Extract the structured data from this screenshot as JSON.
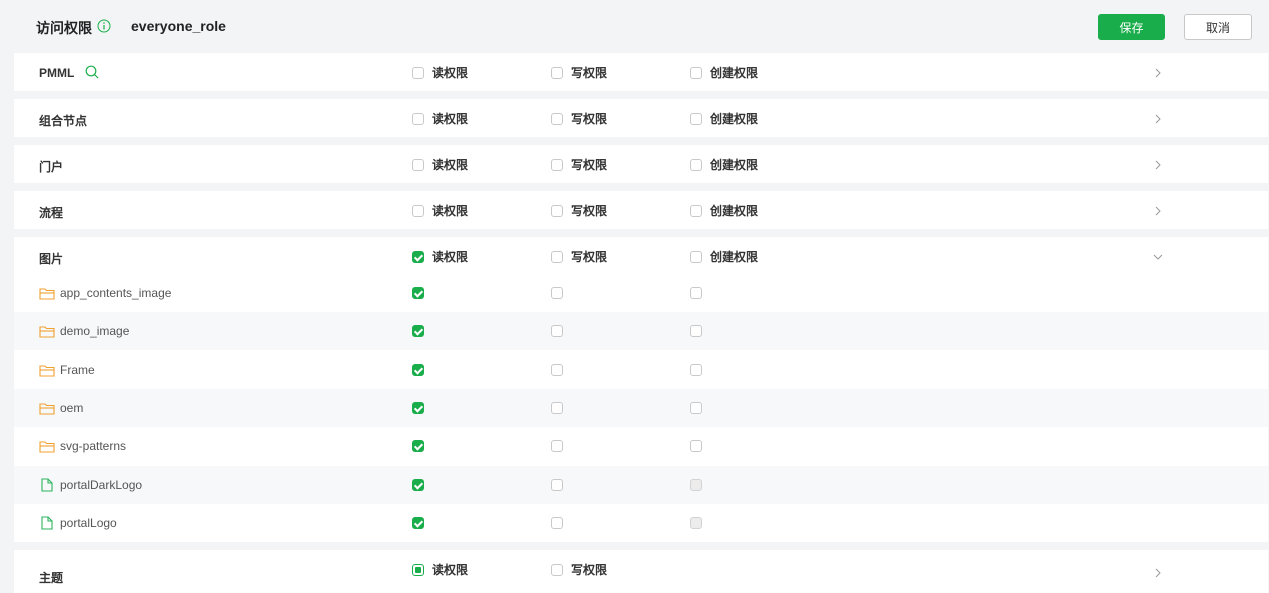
{
  "header": {
    "title": "访问权限",
    "role": "everyone_role",
    "save_label": "保存",
    "cancel_label": "取消"
  },
  "perm_labels": {
    "read": "读权限",
    "write": "写权限",
    "create": "创建权限"
  },
  "categories": [
    {
      "name": "PMML",
      "read": false,
      "write": false,
      "create": false,
      "expanded": false
    },
    {
      "name": "组合节点",
      "read": false,
      "write": false,
      "create": false,
      "expanded": false
    },
    {
      "name": "门户",
      "read": false,
      "write": false,
      "create": false,
      "expanded": false
    },
    {
      "name": "流程",
      "read": false,
      "write": false,
      "create": false,
      "expanded": false
    },
    {
      "name": "图片",
      "read": true,
      "write": false,
      "create": false,
      "expanded": true
    },
    {
      "name": "主题",
      "read": "partial",
      "write": false,
      "expanded": false
    }
  ],
  "image_items": [
    {
      "name": "app_contents_image",
      "icon": "folder-icon",
      "read": true,
      "write": false,
      "create": false
    },
    {
      "name": "demo_image",
      "icon": "folder-icon",
      "read": true,
      "write": false,
      "create": false
    },
    {
      "name": "Frame",
      "icon": "folder-icon",
      "read": true,
      "write": false,
      "create": false
    },
    {
      "name": "oem",
      "icon": "folder-icon",
      "read": true,
      "write": false,
      "create": false
    },
    {
      "name": "svg-patterns",
      "icon": "folder-icon",
      "read": true,
      "write": false,
      "create": false
    },
    {
      "name": "portalDarkLogo",
      "icon": "file-icon",
      "read": true,
      "write": false,
      "create": "disabled"
    },
    {
      "name": "portalLogo",
      "icon": "file-icon",
      "read": true,
      "write": false,
      "create": "disabled"
    }
  ],
  "colors": {
    "accent": "#1aad4b",
    "folder": "#f0a030",
    "file": "#2db35d"
  }
}
